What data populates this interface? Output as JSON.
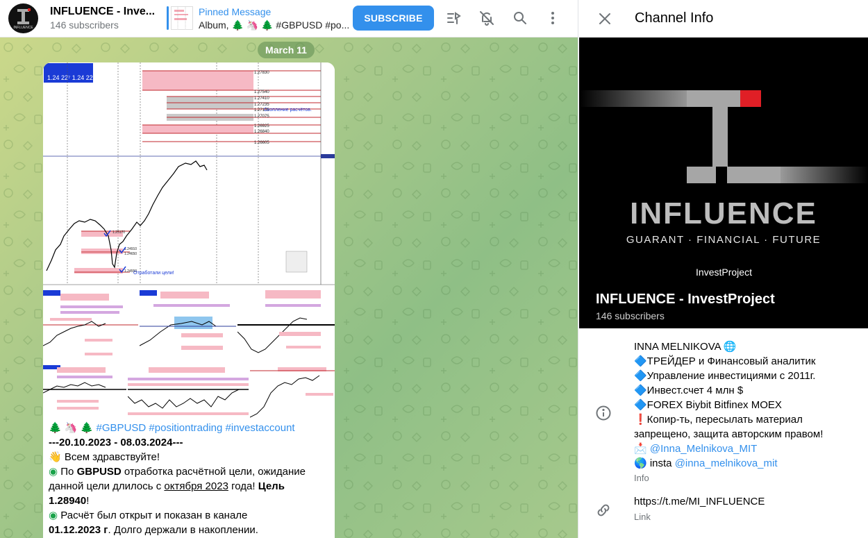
{
  "header": {
    "channel_title": "INFLUENCE - Inve...",
    "subscribers": "146 subscribers",
    "pinned_title": "Pinned Message",
    "pinned_text": "Album, 🌲 🦄 🌲 #GBPUSD #po...",
    "subscribe_label": "SUBSCRIBE",
    "avatar_text": "INFLUENCE",
    "icons": [
      "video-chat-icon",
      "mute-icon",
      "search-icon",
      "more-icon"
    ]
  },
  "chat": {
    "date": "March 11",
    "chart": {
      "levels": [
        "1.27830",
        "1.27540",
        "1.27410",
        "1.27235",
        "1.27135",
        "1.27075",
        "1.26925",
        "1.26840",
        "1.26605"
      ],
      "annotation_top": "Скопление расчётов.",
      "annotation_bottom": "Отработали цели!",
      "lower_levels": [
        "1.25170",
        "1.24910",
        "1.24650",
        "1.24550"
      ]
    },
    "message": {
      "line1_emoji": "🌲 🦄 🌲",
      "tags": [
        "#GBPUSD",
        "#positiontrading",
        "#investaccount"
      ],
      "dates": "---20.10.2023 - 08.03.2024---",
      "greeting_emoji": "👋",
      "greeting": "Всем здравствуйте!",
      "bullet": "◉",
      "p1_a": "По ",
      "p1_b": "GBPUSD",
      "p1_c": " отработка расчётной цели, ожидание",
      "p1_d": "данной цели длилось с ",
      "p1_e": "октября 2023",
      "p1_f": " года! ",
      "p1_g": "Цель",
      "p1_h": "1.28940",
      "p1_i": "!",
      "p2_a": "Расчёт был открыт и показан в канале",
      "p2_b": "01.12.2023 г",
      "p2_c": ". Долго держали в накоплении."
    }
  },
  "panel": {
    "title": "Channel Info",
    "cover_brand": "INFLUENCE",
    "cover_tagline": "GUARANT · FINANCIAL · FUTURE",
    "cover_project": "InvestProject",
    "name": "INFLUENCE - InvestProject",
    "subscribers": "146 subscribers",
    "info_lines": [
      "INNA MELNIKOVA 🌐",
      "🔷ТРЕЙДЕР и Финансовый аналитик",
      "🔷Управление инвестициями с 2011г.",
      "🔷Инвест.счет 4 млн $",
      "🔷FOREX Biybit Bitfinex MOEX",
      "❗Копир-ть, пересылать материал",
      "запрещено, защита авторским правом!"
    ],
    "contact_emoji": "📩",
    "contact_handle": "@Inna_Melnikova_MIT",
    "insta_prefix": "🌎 insta ",
    "insta_handle": "@inna_melnikova_mit",
    "info_caption": "Info",
    "link": "https://t.me/MI_INFLUENCE",
    "link_caption": "Link"
  },
  "colors": {
    "accent": "#3390ec",
    "chat_bg": "#a9c98a",
    "bubble": "#ffffff"
  }
}
